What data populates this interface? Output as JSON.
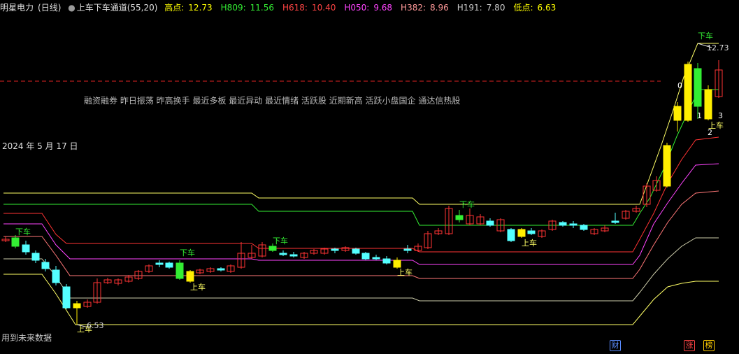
{
  "header": {
    "stock": "明星电力",
    "period": "(日线)",
    "indicator": "上车下车通道(55,20)",
    "stats": [
      {
        "label": "高点:",
        "value": "12.73",
        "color": "#ffff00"
      },
      {
        "label": "H809:",
        "value": "11.56",
        "color": "#33ee33"
      },
      {
        "label": "H618:",
        "value": "10.40",
        "color": "#ff4444"
      },
      {
        "label": "H050:",
        "value": "9.68",
        "color": "#ff44ff"
      },
      {
        "label": "H382:",
        "value": "8.96",
        "color": "#ff9999"
      },
      {
        "label": "H191:",
        "value": "7.80",
        "color": "#cccccc"
      },
      {
        "label": "低点:",
        "value": "6.63",
        "color": "#ffff00"
      }
    ]
  },
  "concepts": "融资融券 昨日振荡 昨高换手 最近多板 最近异动 最近情绪 活跃股 近期新高 活跃小盘国企 通达信热股",
  "date_label": "2024 年 5 月 17 日",
  "future_note": "用到未来数据",
  "signals": {
    "buy": "上车",
    "sell": "下车"
  },
  "price_marks": {
    "high": "12.73",
    "low": "6.53"
  },
  "wave_labels": [
    "0",
    "1",
    "2",
    "3"
  ],
  "tags": [
    {
      "text": "财",
      "color": "#5a8cff"
    },
    {
      "text": "涨",
      "color": "#ff4444"
    },
    {
      "text": "榜",
      "color": "#ffcc00"
    }
  ],
  "colors": {
    "up": "#ff3333",
    "down": "#54ffff",
    "buy_candle": "#ffee00",
    "sell_candle": "#33ee33",
    "channel_top": "#ffff66",
    "channel_2": "#33ee33",
    "channel_3": "#ff3333",
    "channel_4": "#ff44ff",
    "channel_5": "#ff7777",
    "channel_6": "#ccccaa",
    "channel_bottom": "#ffff66"
  }
}
